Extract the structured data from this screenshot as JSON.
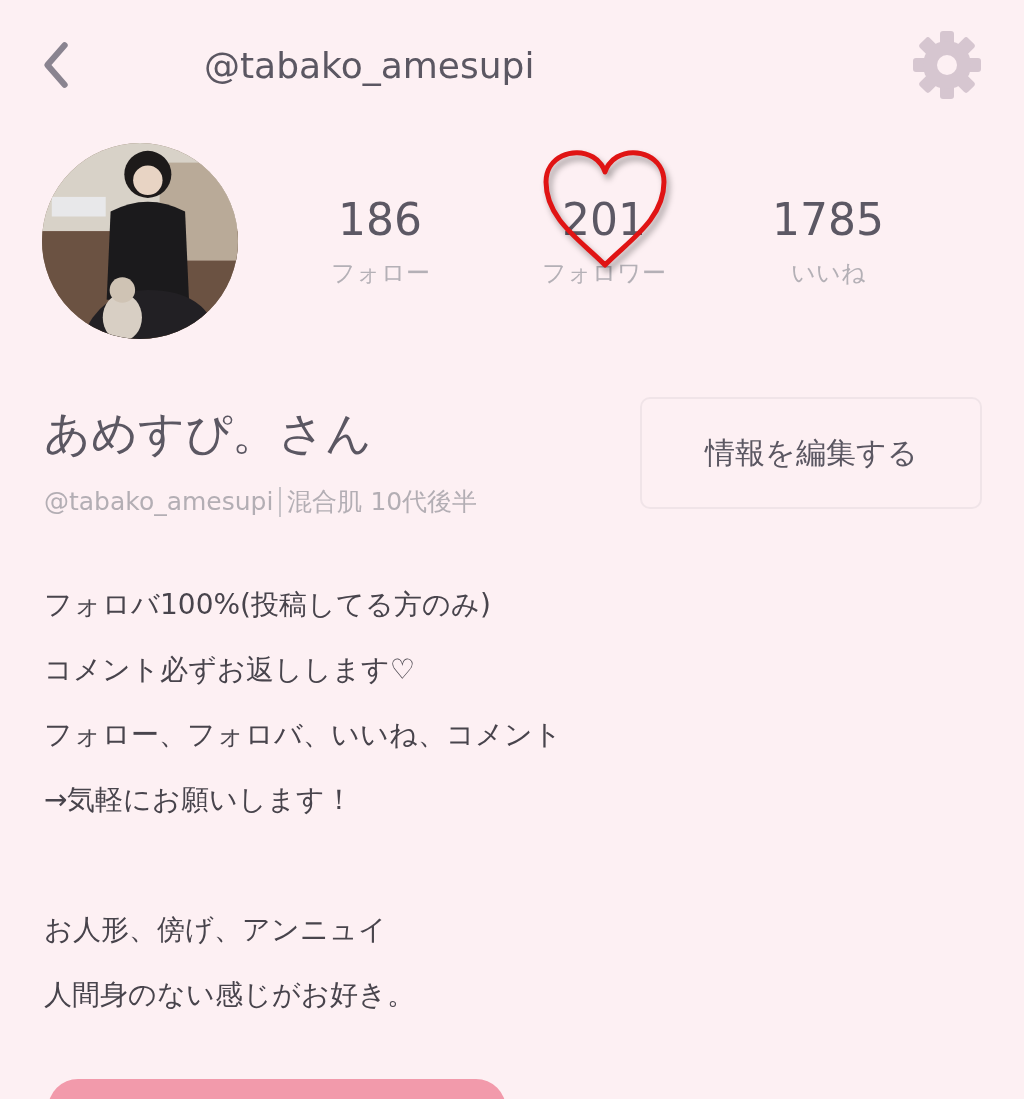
{
  "header": {
    "title": "@tabako_amesupi"
  },
  "stats": [
    {
      "value": "186",
      "label": "フォロー",
      "highlighted": false
    },
    {
      "value": "201",
      "label": "フォロワー",
      "highlighted": true
    },
    {
      "value": "1785",
      "label": "いいね",
      "highlighted": false
    }
  ],
  "profile": {
    "name": "あめすぴ。さん",
    "handle": "@tabako_amesupi",
    "details": "混合肌 10代後半",
    "edit_button": "情報を編集する"
  },
  "bio": [
    [
      "フォロバ100%(投稿してる方のみ)",
      "コメント必ずお返しします♡",
      "フォロー、フォロバ、いいね、コメント",
      "→気軽にお願いします！"
    ],
    [
      "お人形、傍げ、アンニュイ",
      "人間身のない感じがお好き。"
    ]
  ]
}
